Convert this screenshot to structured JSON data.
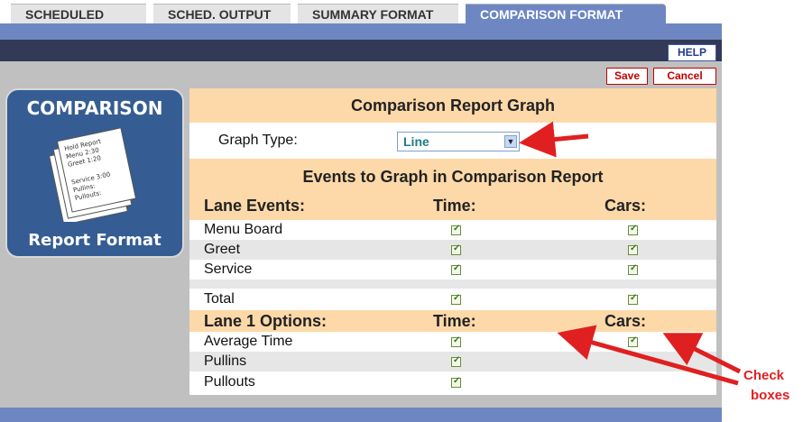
{
  "tabs": [
    {
      "label": "SCHEDULED"
    },
    {
      "label": "SCHED. OUTPUT"
    },
    {
      "label": "SUMMARY FORMAT"
    },
    {
      "label": "COMPARISON FORMAT"
    }
  ],
  "toolbar": {
    "help": "HELP",
    "save": "Save",
    "cancel": "Cancel"
  },
  "badge": {
    "title": "COMPARISON",
    "footer": "Report Format",
    "paper_lines": [
      "Hold Report",
      "Menu 2:30",
      "Greet 1:20",
      "Service 3:00",
      "Pullins:",
      "Pullouts:"
    ]
  },
  "report": {
    "title": "Comparison Report Graph",
    "graph_type_label": "Graph Type:",
    "graph_type_value": "Line",
    "events_title": "Events to Graph in Comparison Report",
    "lane_events": {
      "header": "Lane Events:",
      "time_header": "Time:",
      "cars_header": "Cars:",
      "rows": [
        {
          "label": "Menu Board",
          "time": true,
          "cars": true
        },
        {
          "label": "Greet",
          "time": true,
          "cars": true
        },
        {
          "label": "Service",
          "time": true,
          "cars": true
        }
      ],
      "total": {
        "label": "Total",
        "time": true,
        "cars": true
      }
    },
    "lane_options": {
      "header": "Lane 1 Options:",
      "time_header": "Time:",
      "cars_header": "Cars:",
      "rows": [
        {
          "label": "Average Time",
          "time": true,
          "cars": true
        },
        {
          "label": "Pullins",
          "time": true
        },
        {
          "label": "Pullouts",
          "time": true
        }
      ]
    }
  },
  "annotation": {
    "line1": "Check",
    "line2": "boxes"
  },
  "colors": {
    "accent": "#6e87c2",
    "nav": "#323a57",
    "peach": "#fdd9a9",
    "badge": "#355d93",
    "arrow": "#e02020"
  }
}
